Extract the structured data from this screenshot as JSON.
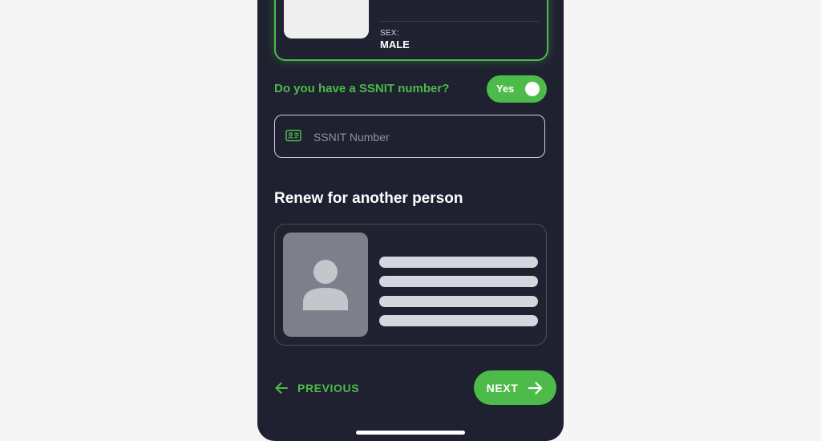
{
  "current_card": {
    "sex_label": "SEX:",
    "sex_value": "MALE"
  },
  "ssnit": {
    "question": "Do you have a SSNIT number?",
    "toggle_label": "Yes",
    "toggle_on": true,
    "input_value": "",
    "input_placeholder": "SSNIT Number",
    "icon": "id-card-icon"
  },
  "another_person": {
    "title": "Renew for another person",
    "avatar_icon": "person-avatar-icon"
  },
  "nav": {
    "previous_label": "PREVIOUS",
    "next_label": "NEXT"
  },
  "colors": {
    "accent": "#4cbb4a",
    "background": "#1f2130",
    "page_bg": "#f5f5f5",
    "placeholder_line": "#d3d8de"
  }
}
